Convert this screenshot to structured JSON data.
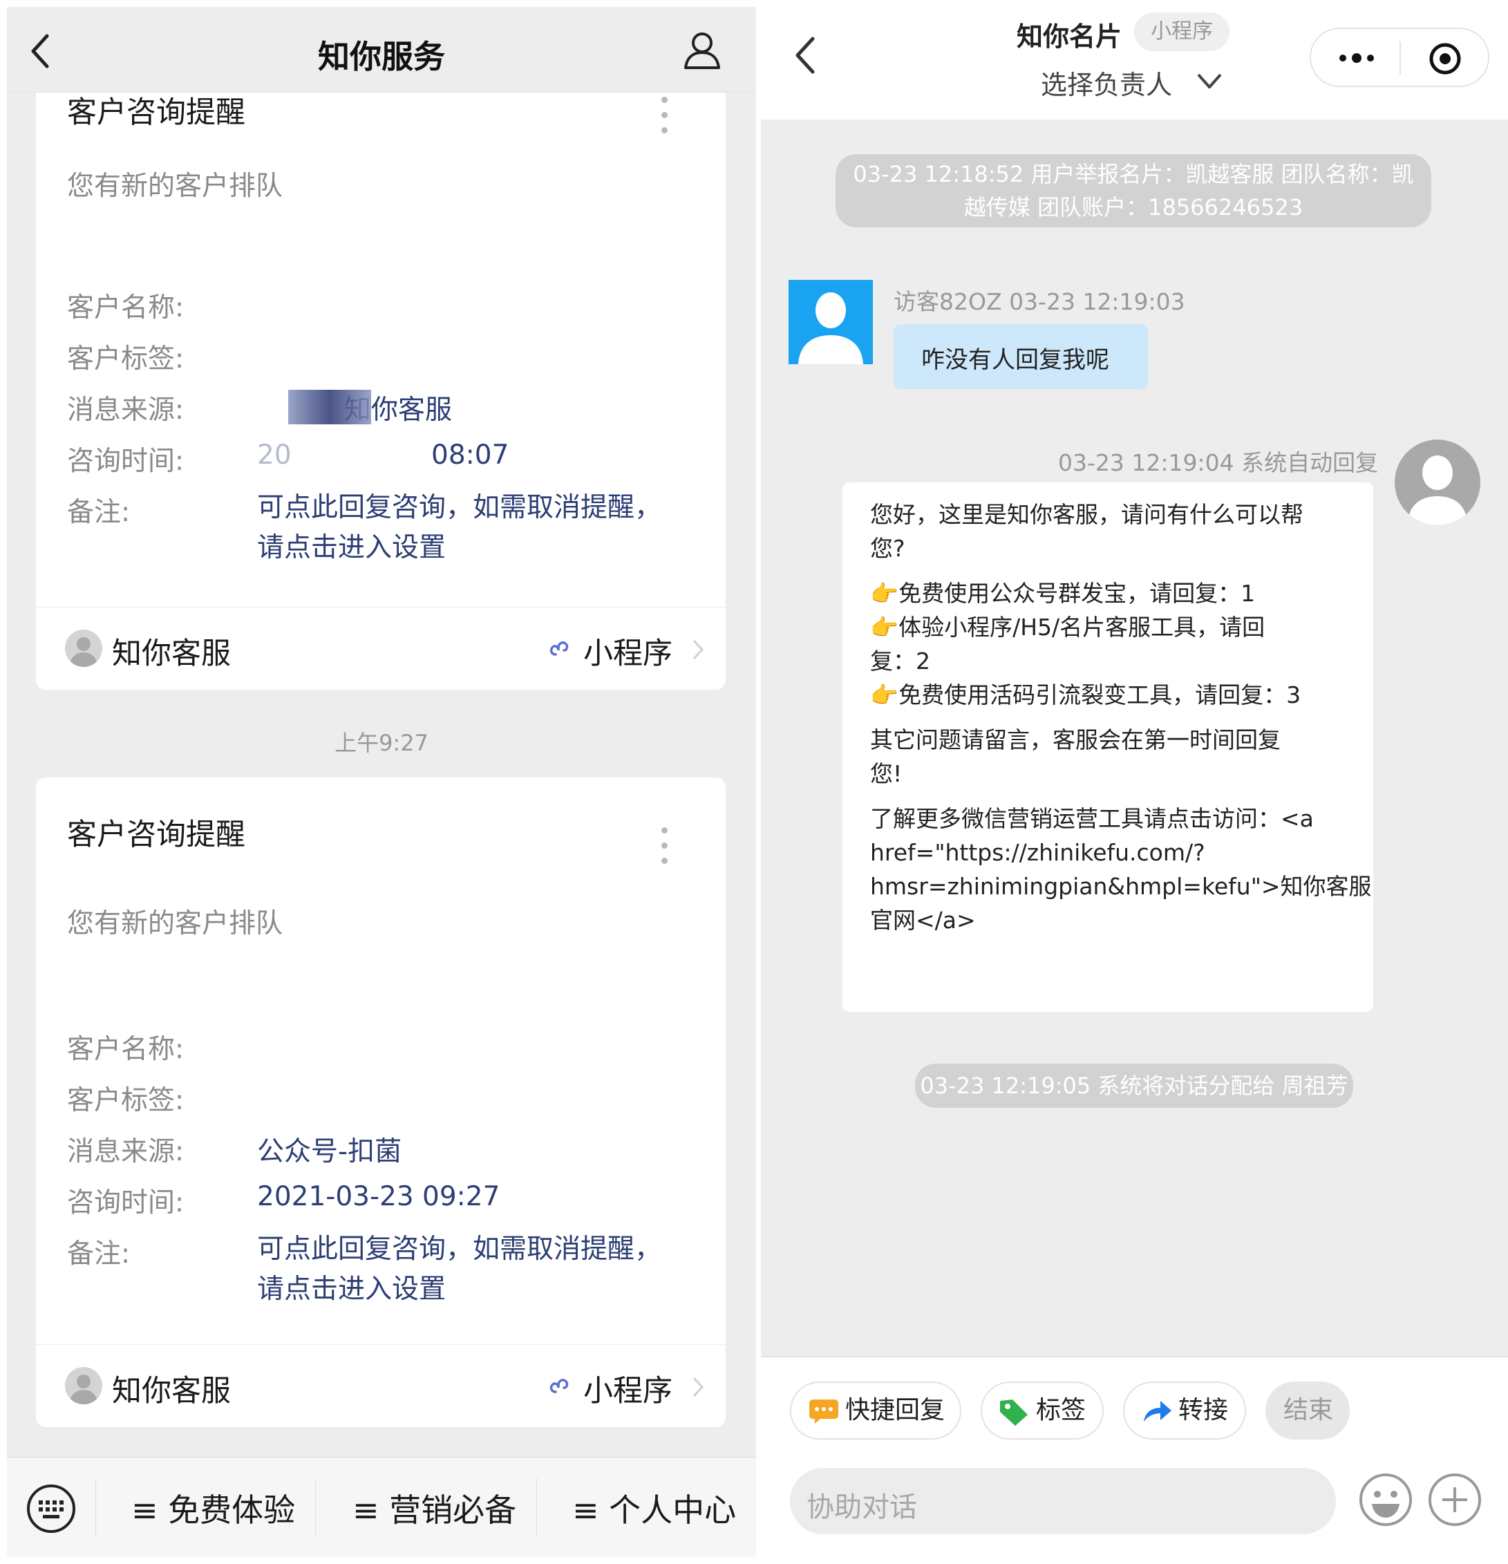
{
  "left": {
    "header": {
      "title": "知你服务"
    },
    "card1": {
      "title": "客户咨询提醒",
      "subtitle": "您有新的客户排队",
      "label_name": "客户名称:",
      "label_tag": "客户标签:",
      "label_source": "消息来源:",
      "label_time": "咨询时间:",
      "label_note": "备注:",
      "value_source": "知你客服",
      "value_time_prefix": "20",
      "value_time_suffix": "08:07",
      "note_line1": "可点此回复咨询，如需取消提醒，",
      "note_line2": "请点击进入设置",
      "footer_name": "知你客服",
      "footer_mini": "小程序"
    },
    "timestamp": "上午9:27",
    "card2": {
      "title": "客户咨询提醒",
      "subtitle": "您有新的客户排队",
      "label_name": "客户名称:",
      "label_tag": "客户标签:",
      "label_source": "消息来源:",
      "label_time": "咨询时间:",
      "label_note": "备注:",
      "value_source": "公众号-扣菌",
      "value_time": "2021-03-23 09:27",
      "note_line1": "可点此回复咨询，如需取消提醒，",
      "note_line2": "请点击进入设置",
      "footer_name": "知你客服",
      "footer_mini": "小程序"
    },
    "bottom_menu": {
      "item1": "≡ 免费体验",
      "item2": "≡ 营销必备",
      "item3": "≡ 个人中心"
    }
  },
  "right": {
    "header": {
      "title": "知你名片",
      "badge": "小程序",
      "subtitle": "选择负责人"
    },
    "system_msg1_line1": "03-23 12:18:52 用户举报名片：凯越客服 团队名称：凯",
    "system_msg1_line2": "越传媒 团队账户：18566246523",
    "visitor": {
      "meta": "访客82OZ 03-23 12:19:03",
      "message": "咋没有人回复我呢"
    },
    "auto_reply": {
      "meta": "03-23 12:19:04 系统自动回复",
      "lines": [
        "您好，这里是知你客服，请问有什么可以帮",
        "您?",
        "",
        "👉免费使用公众号群发宝，请回复：1",
        "👉体验小程序/H5/名片客服工具，请回",
        "复：2",
        "👉免费使用活码引流裂变工具，请回复：3",
        "",
        "其它问题请留言，客服会在第一时间回复",
        "您!",
        "",
        "了解更多微信营销运营工具请点击访问：<a",
        "href=\"https://zhinikefu.com/?",
        "hmsr=zhinimingpian&hmpl=kefu\">知你客服",
        "官网</a>"
      ]
    },
    "system_msg2": "03-23 12:19:05 系统将对话分配给 周祖芳",
    "actions": {
      "quick_reply": "快捷回复",
      "tag": "标签",
      "transfer": "转接",
      "end": "结束"
    },
    "input": {
      "placeholder": "协助对话"
    }
  },
  "colors": {
    "link_blue": "#2c3e74",
    "bubble_blue": "#cde8fb",
    "system_pill": "#d2d2d2",
    "avatar_blue": "#1aa3f0"
  }
}
